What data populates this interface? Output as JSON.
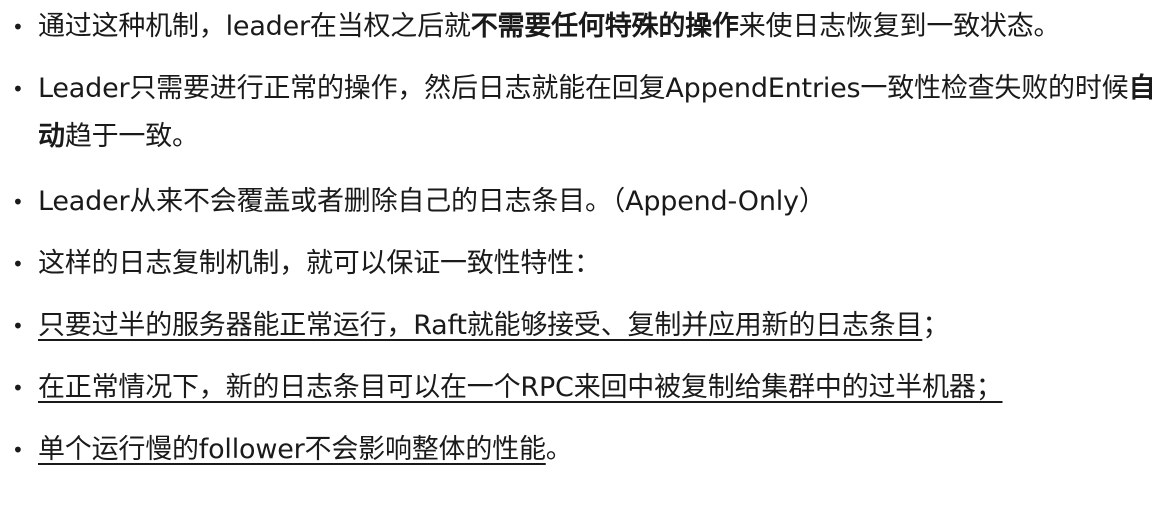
{
  "bullet_char": "•",
  "items": [
    {
      "parts": [
        {
          "text": "通过这种机制，leader在当权之后就"
        },
        {
          "text": "不需要任何特殊的操作"
        },
        {
          "text": "来使日志恢复到一致状态。"
        }
      ]
    },
    {
      "parts": [
        {
          "text": "Leader只需要进行正常的操作，然后日志就能在回复AppendEntries一致性检查失败的时候"
        },
        {
          "text": "自动"
        },
        {
          "text": "趋于一致。"
        }
      ]
    },
    {
      "parts": [
        {
          "text": "Leader从来不会覆盖或者删除自己的日志条目。（Append-Only）"
        }
      ]
    },
    {
      "parts": [
        {
          "text": "这样的日志复制机制，就可以保证一致性特性："
        }
      ]
    },
    {
      "parts": [
        {
          "text": "只要过半的服务器能正常运行，Raft就能够接受、复制并应用新的日志条目"
        },
        {
          "text": "；"
        }
      ]
    },
    {
      "parts": [
        {
          "text": "在正常情况下，新的日志条目可以在一个RPC来回中被复制给集群中的过半机器；"
        }
      ]
    },
    {
      "parts": [
        {
          "text": "单个运行慢的follower不会影响整体的性能"
        },
        {
          "text": "。"
        }
      ]
    }
  ]
}
